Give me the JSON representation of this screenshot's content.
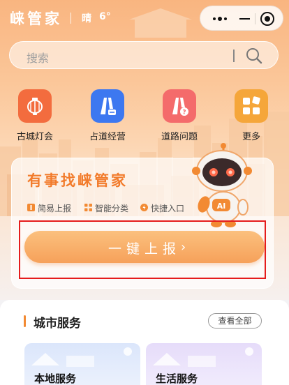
{
  "header": {
    "app_title": "崃管家",
    "weather": "晴",
    "temperature": "6°"
  },
  "search": {
    "placeholder": "搜索"
  },
  "quick_actions": [
    {
      "label": "古城灯会",
      "icon": "lantern-icon",
      "color": "#f36c3e"
    },
    {
      "label": "占道经营",
      "icon": "road-stall-icon",
      "color": "#3d78f0"
    },
    {
      "label": "道路问题",
      "icon": "road-question-icon",
      "color": "#f46b6b"
    },
    {
      "label": "更多",
      "icon": "grid-more-icon",
      "color": "#f5a63a"
    }
  ],
  "report_card": {
    "title": "有事找崃管家",
    "features": [
      {
        "label": "简易上报",
        "icon": "report-icon"
      },
      {
        "label": "智能分类",
        "icon": "category-icon"
      },
      {
        "label": "快捷入口",
        "icon": "entrance-icon"
      }
    ],
    "button_label": "一键上报",
    "button_chevron": "›",
    "mascot_badge": "AI"
  },
  "city_services": {
    "title": "城市服务",
    "view_all": "查看全部",
    "cards": [
      {
        "label": "本地服务"
      },
      {
        "label": "生活服务"
      }
    ]
  },
  "colors": {
    "accent": "#f27b2b",
    "highlight_border": "#e51c1c",
    "button": "#f6a15a"
  }
}
